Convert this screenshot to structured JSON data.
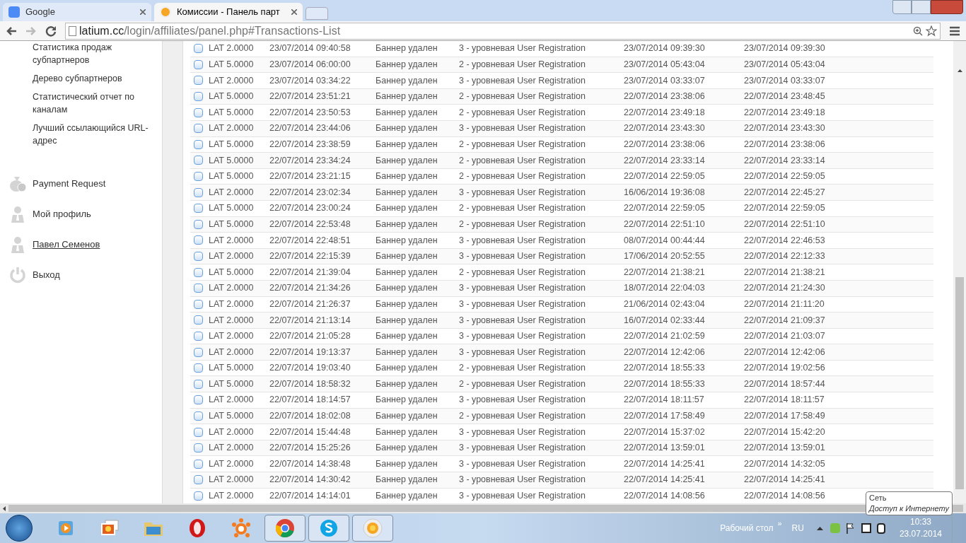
{
  "browser": {
    "tabs": [
      {
        "title": "Google",
        "selected": false
      },
      {
        "title": "Комиссии - Панель парт",
        "selected": true
      }
    ],
    "address": {
      "host": "latium.cc",
      "path": "/login/affiliates/panel.php#Transactions-List"
    }
  },
  "sidebar": {
    "links": [
      "Статистика продаж субпартнеров",
      "Дерево субпартнеров",
      "Статистический отчет по каналам",
      "Лучший ссылающийся URL-адрес"
    ],
    "items": [
      {
        "label": "Payment Request",
        "kind": "money",
        "underlined": false
      },
      {
        "label": "Мой профиль",
        "kind": "person",
        "underlined": false
      },
      {
        "label": "Павел Семенов",
        "kind": "person",
        "underlined": true
      },
      {
        "label": "Выход",
        "kind": "power",
        "underlined": false
      }
    ]
  },
  "table": {
    "rows": [
      [
        "LAT 2.0000",
        "23/07/2014 09:40:58",
        "Баннер удален",
        "3 - уровневая User Registration",
        "23/07/2014 09:39:30",
        "23/07/2014 09:39:30"
      ],
      [
        "LAT 5.0000",
        "23/07/2014 06:00:00",
        "Баннер удален",
        "2 - уровневая User Registration",
        "23/07/2014 05:43:04",
        "23/07/2014 05:43:04"
      ],
      [
        "LAT 2.0000",
        "23/07/2014 03:34:22",
        "Баннер удален",
        "3 - уровневая User Registration",
        "23/07/2014 03:33:07",
        "23/07/2014 03:33:07"
      ],
      [
        "LAT 5.0000",
        "22/07/2014 23:51:21",
        "Баннер удален",
        "2 - уровневая User Registration",
        "22/07/2014 23:38:06",
        "22/07/2014 23:48:45"
      ],
      [
        "LAT 5.0000",
        "22/07/2014 23:50:53",
        "Баннер удален",
        "2 - уровневая User Registration",
        "22/07/2014 23:49:18",
        "22/07/2014 23:49:18"
      ],
      [
        "LAT 2.0000",
        "22/07/2014 23:44:06",
        "Баннер удален",
        "3 - уровневая User Registration",
        "22/07/2014 23:43:30",
        "22/07/2014 23:43:30"
      ],
      [
        "LAT 5.0000",
        "22/07/2014 23:38:59",
        "Баннер удален",
        "2 - уровневая User Registration",
        "22/07/2014 23:38:06",
        "22/07/2014 23:38:06"
      ],
      [
        "LAT 5.0000",
        "22/07/2014 23:34:24",
        "Баннер удален",
        "2 - уровневая User Registration",
        "22/07/2014 23:33:14",
        "22/07/2014 23:33:14"
      ],
      [
        "LAT 5.0000",
        "22/07/2014 23:21:15",
        "Баннер удален",
        "2 - уровневая User Registration",
        "22/07/2014 22:59:05",
        "22/07/2014 22:59:05"
      ],
      [
        "LAT 2.0000",
        "22/07/2014 23:02:34",
        "Баннер удален",
        "3 - уровневая User Registration",
        "16/06/2014 19:36:08",
        "22/07/2014 22:45:27"
      ],
      [
        "LAT 5.0000",
        "22/07/2014 23:00:24",
        "Баннер удален",
        "2 - уровневая User Registration",
        "22/07/2014 22:59:05",
        "22/07/2014 22:59:05"
      ],
      [
        "LAT 5.0000",
        "22/07/2014 22:53:48",
        "Баннер удален",
        "2 - уровневая User Registration",
        "22/07/2014 22:51:10",
        "22/07/2014 22:51:10"
      ],
      [
        "LAT 2.0000",
        "22/07/2014 22:48:51",
        "Баннер удален",
        "3 - уровневая User Registration",
        "08/07/2014 00:44:44",
        "22/07/2014 22:46:53"
      ],
      [
        "LAT 2.0000",
        "22/07/2014 22:15:39",
        "Баннер удален",
        "3 - уровневая User Registration",
        "17/06/2014 20:52:55",
        "22/07/2014 22:12:33"
      ],
      [
        "LAT 5.0000",
        "22/07/2014 21:39:04",
        "Баннер удален",
        "2 - уровневая User Registration",
        "22/07/2014 21:38:21",
        "22/07/2014 21:38:21"
      ],
      [
        "LAT 2.0000",
        "22/07/2014 21:34:26",
        "Баннер удален",
        "3 - уровневая User Registration",
        "18/07/2014 22:04:03",
        "22/07/2014 21:24:30"
      ],
      [
        "LAT 2.0000",
        "22/07/2014 21:26:37",
        "Баннер удален",
        "3 - уровневая User Registration",
        "21/06/2014 02:43:04",
        "22/07/2014 21:11:20"
      ],
      [
        "LAT 2.0000",
        "22/07/2014 21:13:14",
        "Баннер удален",
        "3 - уровневая User Registration",
        "16/07/2014 02:33:44",
        "22/07/2014 21:09:37"
      ],
      [
        "LAT 2.0000",
        "22/07/2014 21:05:28",
        "Баннер удален",
        "3 - уровневая User Registration",
        "22/07/2014 21:02:59",
        "22/07/2014 21:03:07"
      ],
      [
        "LAT 2.0000",
        "22/07/2014 19:13:37",
        "Баннер удален",
        "3 - уровневая User Registration",
        "22/07/2014 12:42:06",
        "22/07/2014 12:42:06"
      ],
      [
        "LAT 5.0000",
        "22/07/2014 19:03:40",
        "Баннер удален",
        "2 - уровневая User Registration",
        "22/07/2014 18:55:33",
        "22/07/2014 19:02:56"
      ],
      [
        "LAT 5.0000",
        "22/07/2014 18:58:32",
        "Баннер удален",
        "2 - уровневая User Registration",
        "22/07/2014 18:55:33",
        "22/07/2014 18:57:44"
      ],
      [
        "LAT 2.0000",
        "22/07/2014 18:14:57",
        "Баннер удален",
        "3 - уровневая User Registration",
        "22/07/2014 18:11:57",
        "22/07/2014 18:11:57"
      ],
      [
        "LAT 5.0000",
        "22/07/2014 18:02:08",
        "Баннер удален",
        "2 - уровневая User Registration",
        "22/07/2014 17:58:49",
        "22/07/2014 17:58:49"
      ],
      [
        "LAT 2.0000",
        "22/07/2014 15:44:48",
        "Баннер удален",
        "3 - уровневая User Registration",
        "22/07/2014 15:37:02",
        "22/07/2014 15:42:20"
      ],
      [
        "LAT 2.0000",
        "22/07/2014 15:25:26",
        "Баннер удален",
        "3 - уровневая User Registration",
        "22/07/2014 13:59:01",
        "22/07/2014 13:59:01"
      ],
      [
        "LAT 2.0000",
        "22/07/2014 14:38:48",
        "Баннер удален",
        "3 - уровневая User Registration",
        "22/07/2014 14:25:41",
        "22/07/2014 14:32:05"
      ],
      [
        "LAT 2.0000",
        "22/07/2014 14:30:42",
        "Баннер удален",
        "3 - уровневая User Registration",
        "22/07/2014 14:25:41",
        "22/07/2014 14:25:41"
      ],
      [
        "LAT 2.0000",
        "22/07/2014 14:14:01",
        "Баннер удален",
        "3 - уровневая User Registration",
        "22/07/2014 14:08:56",
        "22/07/2014 14:08:56"
      ]
    ]
  },
  "tooltip": {
    "title": "Сеть",
    "text": "Доступ к Интернету"
  },
  "taskbar": {
    "apps": [
      {
        "kind": "media",
        "active": false
      },
      {
        "kind": "photos",
        "active": false
      },
      {
        "kind": "folder",
        "active": false
      },
      {
        "kind": "opera",
        "active": false
      },
      {
        "kind": "antivirus",
        "active": false
      },
      {
        "kind": "chrome",
        "active": true
      },
      {
        "kind": "skype",
        "active": true
      },
      {
        "kind": "sun",
        "active": true
      }
    ],
    "desktop": "Рабочий стол",
    "more": "»",
    "language": "RU",
    "time": "10:33",
    "date": "23.07.2014"
  }
}
